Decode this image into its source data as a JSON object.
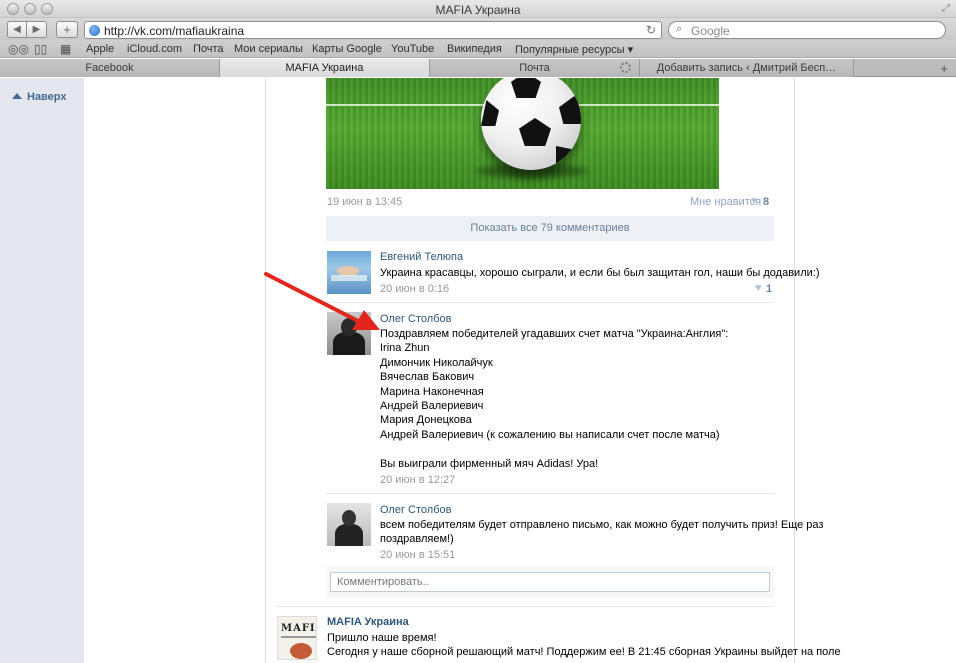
{
  "browser": {
    "window_title": "MAFIA Украина",
    "url": "http://vk.com/mafiaukraina",
    "search_placeholder": "Google",
    "back": "◀",
    "forward": "▶",
    "add": "+",
    "bookmarks": [
      "Apple",
      "iCloud.com",
      "Почта",
      "Мои сериалы",
      "Карты Google",
      "YouTube",
      "Википедия",
      "Популярные ресурсы ▾"
    ],
    "tabs": [
      {
        "label": "Facebook",
        "active": false
      },
      {
        "label": "MAFIA Украина",
        "active": true
      },
      {
        "label": "Почта",
        "active": false
      },
      {
        "label": "Добавить запись ‹ Дмитрий Бесп…",
        "active": false
      }
    ]
  },
  "sidebar": {
    "up_label": "Наверх"
  },
  "post": {
    "date": "19 июн в 13:45",
    "like_label": "Мне нравится",
    "like_count": "8",
    "show_all_label": "Показать все 79 комментариев"
  },
  "comments": [
    {
      "author": "Евгений Телюпа",
      "lines": [
        "Украина красавцы, хорошо сыграли, и если бы был защитан гол, наши бы додавили:)"
      ],
      "date": "20 июн в 0:16",
      "likes": "1"
    },
    {
      "author": "Олег Столбов",
      "lines": [
        "Поздравляем победителей угадавших счет матча \"Украина:Англия\":",
        "Irina Zhun",
        "Димончик Николайчук",
        "Вячеслав Бакович",
        "Марина Наконечная",
        "Андрей Валериевич",
        "Мария Донецкова",
        "Андрей Валериевич (к сожалению вы написали счет после матча)",
        "",
        "Вы выиграли фирменный мяч Adidas! Ура!"
      ],
      "date": "20 июн в 12:27"
    },
    {
      "author": "Олег Столбов",
      "lines": [
        "всем победителям будет отправлено письмо, как можно будет получить приз! Еще раз",
        "поздравляем!)"
      ],
      "date": "20 июн в 15:51"
    }
  ],
  "comment_input": {
    "placeholder": "Комментировать.."
  },
  "next_post": {
    "author": "MAFIA Украина",
    "avatar_text": "MAFIA",
    "lines": [
      "Пришло наше время!",
      "Сегодня у наше сборной решающий матч! Поддержим ее! В 21:45 сборная Украины выйдет на поле"
    ]
  }
}
